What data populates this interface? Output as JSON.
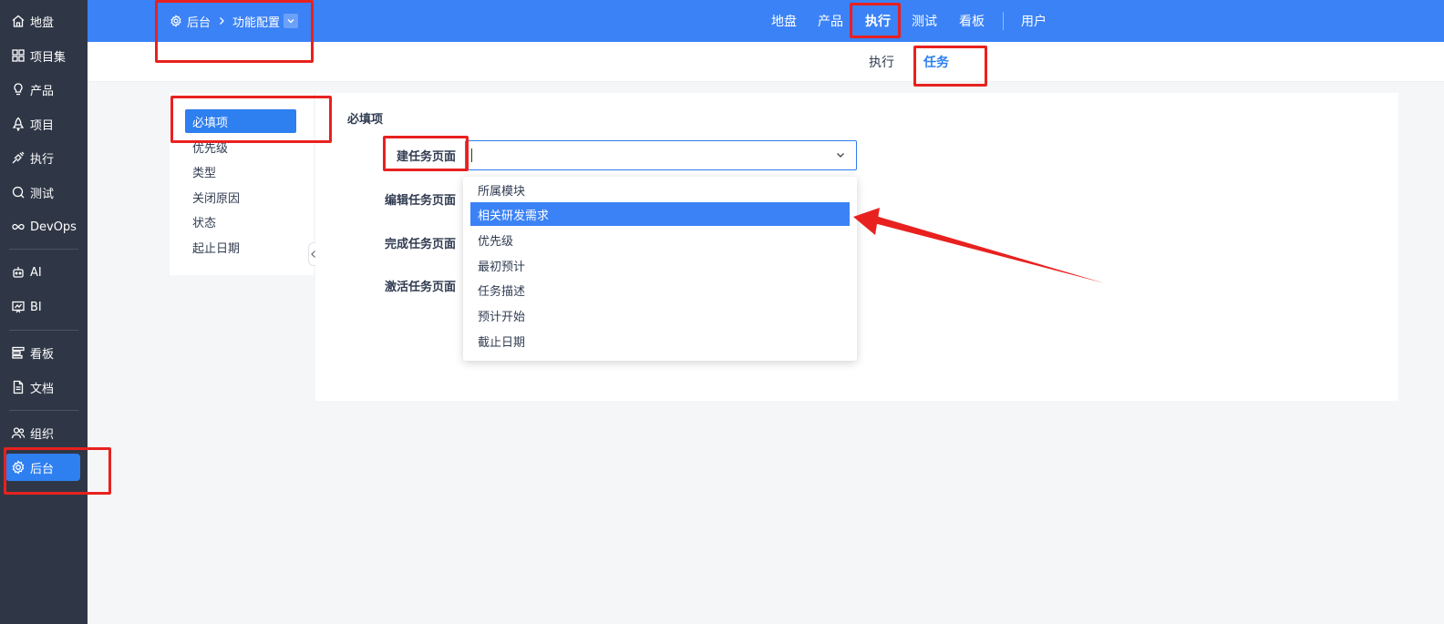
{
  "sidebar": {
    "items": [
      {
        "label": "地盘",
        "icon": "home-icon"
      },
      {
        "label": "项目集",
        "icon": "grid-icon"
      },
      {
        "label": "产品",
        "icon": "lightbulb-icon"
      },
      {
        "label": "项目",
        "icon": "rocket-icon"
      },
      {
        "label": "执行",
        "icon": "run-icon"
      },
      {
        "label": "测试",
        "icon": "magnifier-icon"
      },
      {
        "label": "DevOps",
        "icon": "infinity-icon"
      },
      {
        "label": "AI",
        "icon": "robot-icon"
      },
      {
        "label": "BI",
        "icon": "chart-board-icon"
      },
      {
        "label": "看板",
        "icon": "kanban-icon"
      },
      {
        "label": "文档",
        "icon": "document-icon"
      },
      {
        "label": "组织",
        "icon": "users-icon"
      },
      {
        "label": "后台",
        "icon": "gear-icon"
      }
    ],
    "active": "后台"
  },
  "breadcrumb": {
    "root": "后台",
    "current": "功能配置"
  },
  "topnav": {
    "items": [
      "地盘",
      "产品",
      "执行",
      "测试",
      "看板"
    ],
    "extra": "用户",
    "current": "执行"
  },
  "subnav": {
    "tabs": [
      "执行",
      "任务"
    ],
    "active": "任务"
  },
  "leftmenu": {
    "items": [
      "必填项",
      "优先级",
      "类型",
      "关闭原因",
      "状态",
      "起止日期"
    ],
    "active": "必填项"
  },
  "panel": {
    "title": "必填项",
    "fields": [
      {
        "label": "建任务页面"
      },
      {
        "label": "编辑任务页面"
      },
      {
        "label": "完成任务页面"
      },
      {
        "label": "激活任务页面"
      }
    ]
  },
  "dropdown": {
    "options": [
      "所属模块",
      "相关研发需求",
      "优先级",
      "最初预计",
      "任务描述",
      "预计开始",
      "截止日期"
    ],
    "highlighted": "相关研发需求"
  },
  "colors": {
    "primary": "#3b82f6",
    "sidebar_bg": "#2f3746",
    "annotation": "#e8211f"
  }
}
